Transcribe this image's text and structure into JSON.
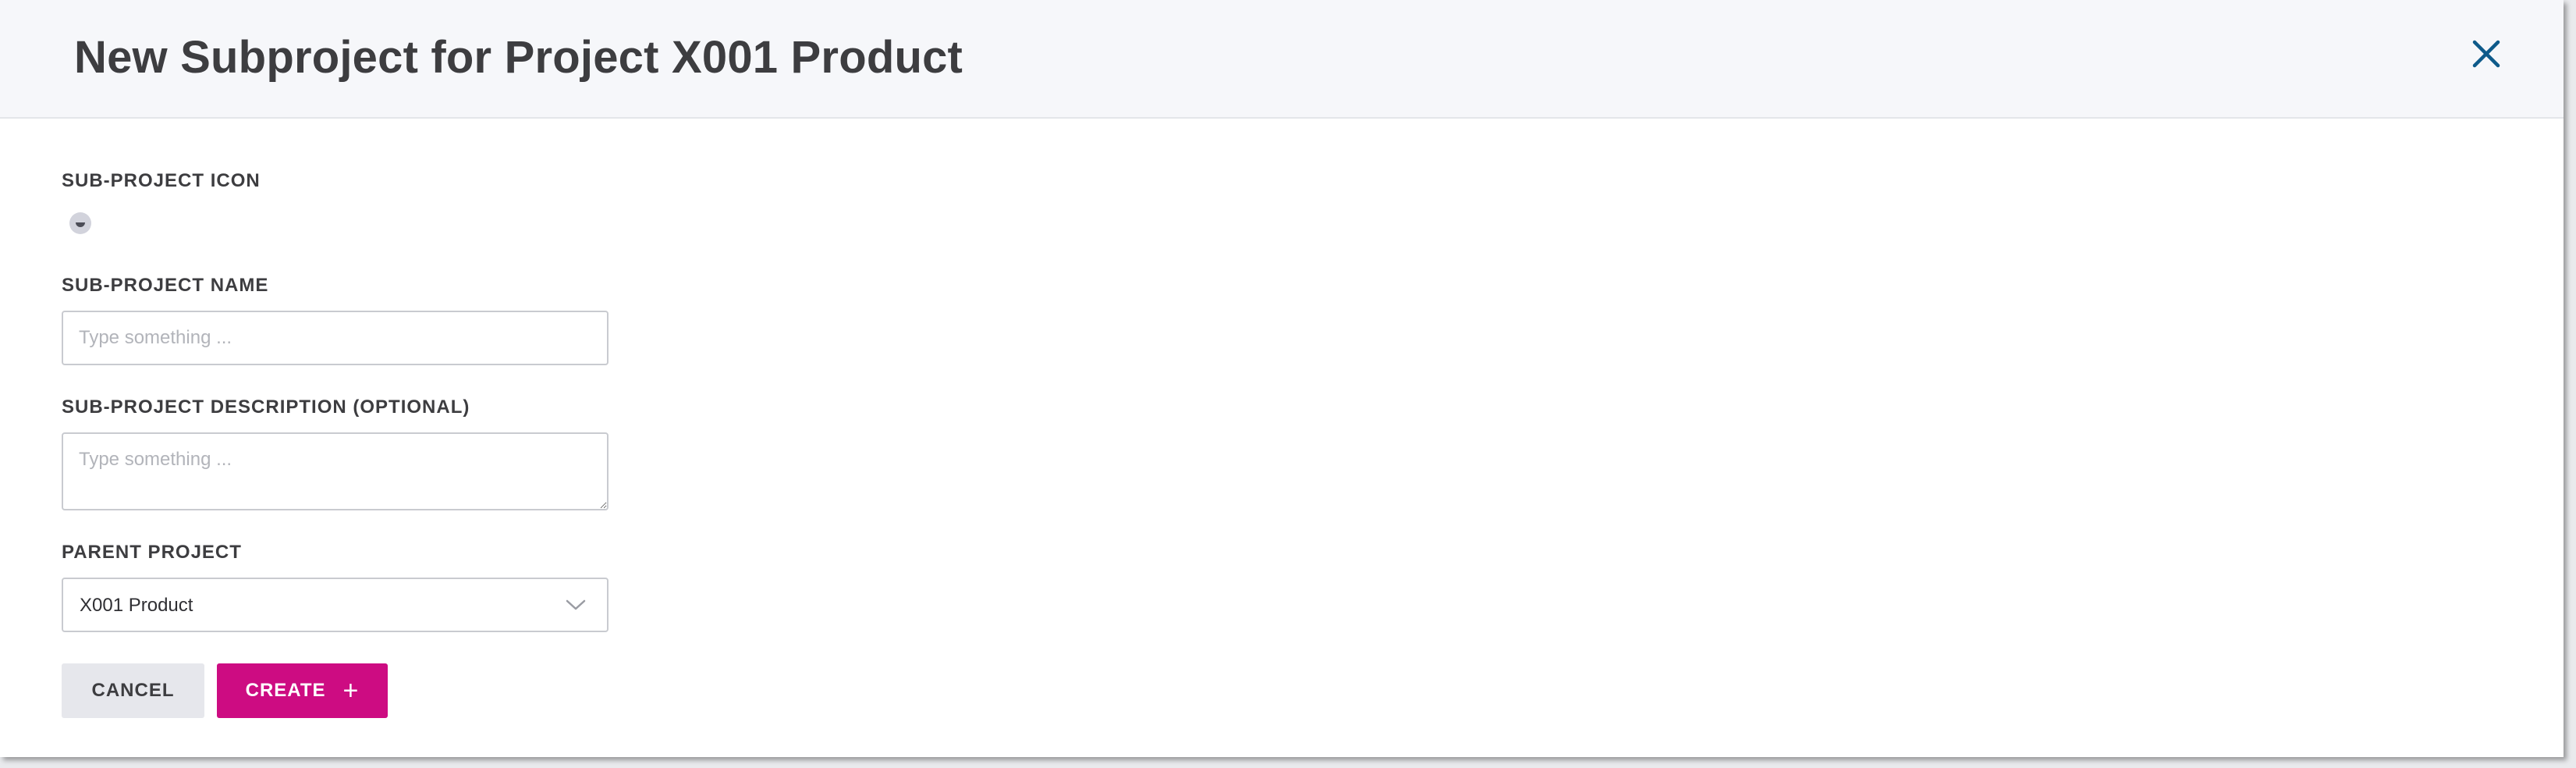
{
  "dialog": {
    "title": "New Subproject for Project X001 Product"
  },
  "form": {
    "icon_label": "SUB-PROJECT ICON",
    "name_label": "SUB-PROJECT NAME",
    "name_value": "",
    "name_placeholder": "Type something ...",
    "description_label": "SUB-PROJECT DESCRIPTION (OPTIONAL)",
    "description_value": "",
    "description_placeholder": "Type something ...",
    "parent_label": "PARENT PROJECT",
    "parent_value": "X001 Product"
  },
  "actions": {
    "cancel_label": "CANCEL",
    "create_label": "CREATE",
    "create_icon": "plus-icon"
  },
  "colors": {
    "accent": "#cd0c82",
    "close_icon": "#0e5a8a",
    "header_bg": "#f6f7fa"
  }
}
